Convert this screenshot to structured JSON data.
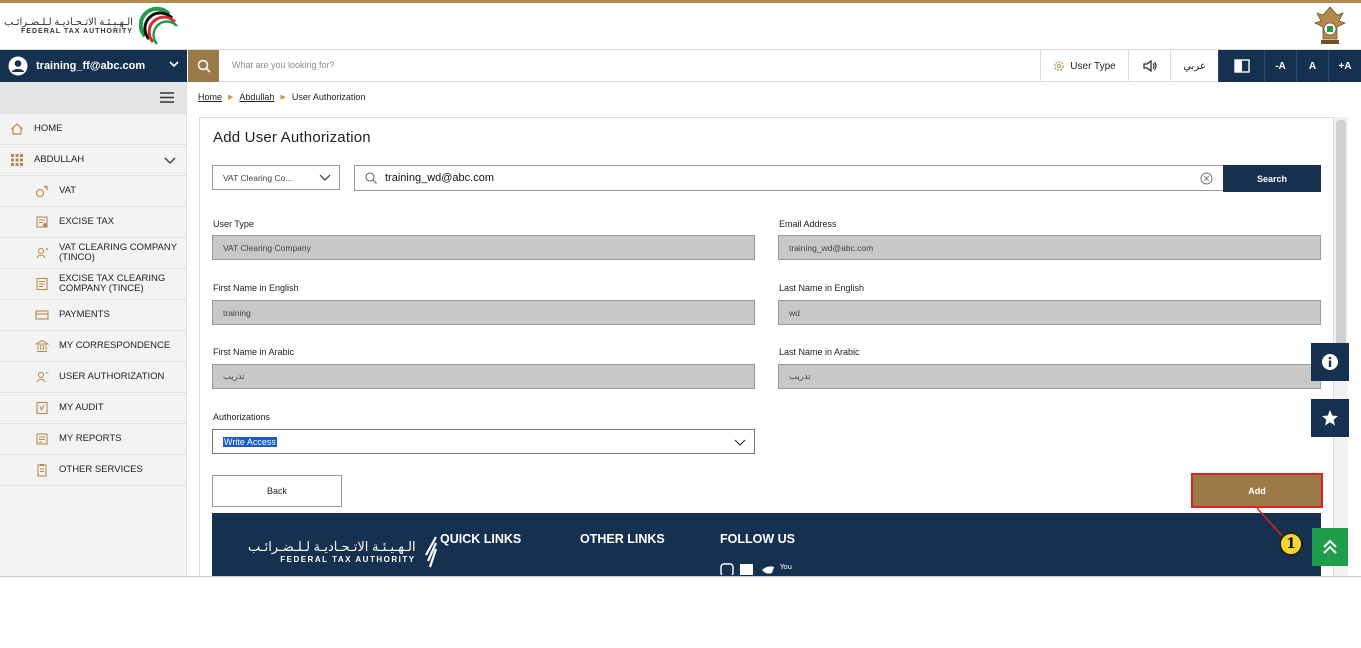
{
  "header": {
    "logo_ar": "الـهـيـئـة الاتـحـاديـة لـلـضـرائـب",
    "logo_en": "FEDERAL TAX AUTHORITY"
  },
  "topbar": {
    "user_email": "training_ff@abc.com",
    "search_placeholder": "What are you looking for?",
    "user_type_label": "User Type",
    "lang_label": "عربي",
    "font_minus": "-A",
    "font_normal": "A",
    "font_plus": "+A"
  },
  "sidebar": {
    "items": [
      {
        "label": "HOME",
        "icon": "home-icon"
      },
      {
        "label": "ABDULLAH",
        "icon": "grid-icon"
      },
      {
        "label": "VAT",
        "icon": "vat-icon"
      },
      {
        "label": "EXCISE TAX",
        "icon": "excise-icon"
      },
      {
        "label": "VAT CLEARING COMPANY (TINCO)",
        "icon": "person-icon"
      },
      {
        "label": "EXCISE TAX CLEARING COMPANY (TINCE)",
        "icon": "document-icon"
      },
      {
        "label": "PAYMENTS",
        "icon": "payment-icon"
      },
      {
        "label": "MY CORRESPONDENCE",
        "icon": "bank-icon"
      },
      {
        "label": "USER AUTHORIZATION",
        "icon": "user-auth-icon"
      },
      {
        "label": "MY AUDIT",
        "icon": "audit-icon"
      },
      {
        "label": "MY REPORTS",
        "icon": "report-icon"
      },
      {
        "label": "OTHER SERVICES",
        "icon": "services-icon"
      }
    ]
  },
  "breadcrumb": {
    "home": "Home",
    "account": "Abdullah",
    "current": "User Authorization"
  },
  "main": {
    "title": "Add User Authorization",
    "type_select": "VAT Clearing Co...",
    "search_value": "training_wd@abc.com",
    "search_button": "Search",
    "fields": {
      "user_type_label": "User Type",
      "user_type_value": "VAT Clearing Company",
      "email_label": "Email Address",
      "email_value": "training_wd@abc.com",
      "first_en_label": "First Name in English",
      "first_en_value": "training",
      "last_en_label": "Last Name in English",
      "last_en_value": "wd",
      "first_ar_label": "First Name in Arabic",
      "first_ar_value": "تدريب",
      "last_ar_label": "Last Name in Arabic",
      "last_ar_value": "تدريب"
    },
    "authorizations_label": "Authorizations",
    "authorizations_value": "Write Access",
    "back_button": "Back",
    "add_button": "Add",
    "callout_number": "1"
  },
  "footer": {
    "logo_ar": "الـهـيـئـة الاتـحـاديـة لـلـضـرائـب",
    "logo_en": "FEDERAL TAX AUTHORITY",
    "quick_links": "QUICK LINKS",
    "other_links": "OTHER LINKS",
    "follow_us": "FOLLOW US"
  },
  "colors": {
    "navy": "#163150",
    "gold": "#9b7a48",
    "highlight_red": "#e02222",
    "green": "#1e9e4a"
  }
}
